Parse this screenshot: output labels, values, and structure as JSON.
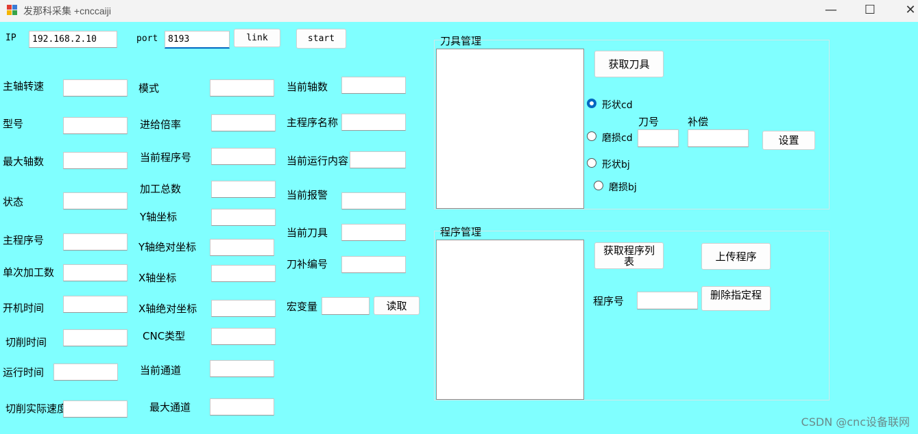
{
  "window": {
    "title": "发那科采集 +cnccaiji",
    "minimize": "—",
    "maximize": "☐",
    "close": "✕"
  },
  "connection": {
    "ip_label": "IP",
    "ip_value": "192.168.2.10",
    "port_label": "port",
    "port_value": "8193",
    "link_label": "link",
    "start_label": "start"
  },
  "col1": {
    "spindle_speed": "主轴转速",
    "model": "型号",
    "max_axes": "最大轴数",
    "status": "状态",
    "main_prog_no": "主程序号",
    "single_count": "单次加工数",
    "power_on_time": "开机时间",
    "cutting_time": "切削时间",
    "run_time": "运行时间",
    "actual_cut_speed": "切削实际速度"
  },
  "col2": {
    "mode": "模式",
    "feed_rate": "进给倍率",
    "current_prog_no": "当前程序号",
    "total_count": "加工总数",
    "y_coord": "Y轴坐标",
    "y_abs_coord": "Y轴绝对坐标",
    "x_coord": "X轴坐标",
    "x_abs_coord": "X轴绝对坐标",
    "cnc_type": "CNC类型",
    "current_channel": "当前通道",
    "max_channel": "最大通道"
  },
  "col3": {
    "current_axes": "当前轴数",
    "main_prog_name": "主程序名称",
    "current_run_content": "当前运行内容",
    "current_alarm": "当前报警",
    "current_tool": "当前刀具",
    "tool_offset_no": "刀补编号",
    "macro_var": "宏变量",
    "read_button": "读取"
  },
  "tool_mgmt": {
    "title": "刀具管理",
    "get_tools": "获取刀具",
    "radios": [
      "形状cd",
      "磨损cd",
      "形状bj",
      "磨损bj"
    ],
    "selected_radio": "形状cd",
    "tool_no_label": "刀号",
    "offset_label": "补偿",
    "set_button": "设置"
  },
  "prog_mgmt": {
    "title": "程序管理",
    "get_list": "获取程序列表",
    "upload": "上传程序",
    "prog_no_label": "程序号",
    "delete": "删除指定程"
  },
  "watermark": "CSDN @cnc设备联网",
  "colors": {
    "background": "#80ffff",
    "accent": "#0067c0"
  }
}
